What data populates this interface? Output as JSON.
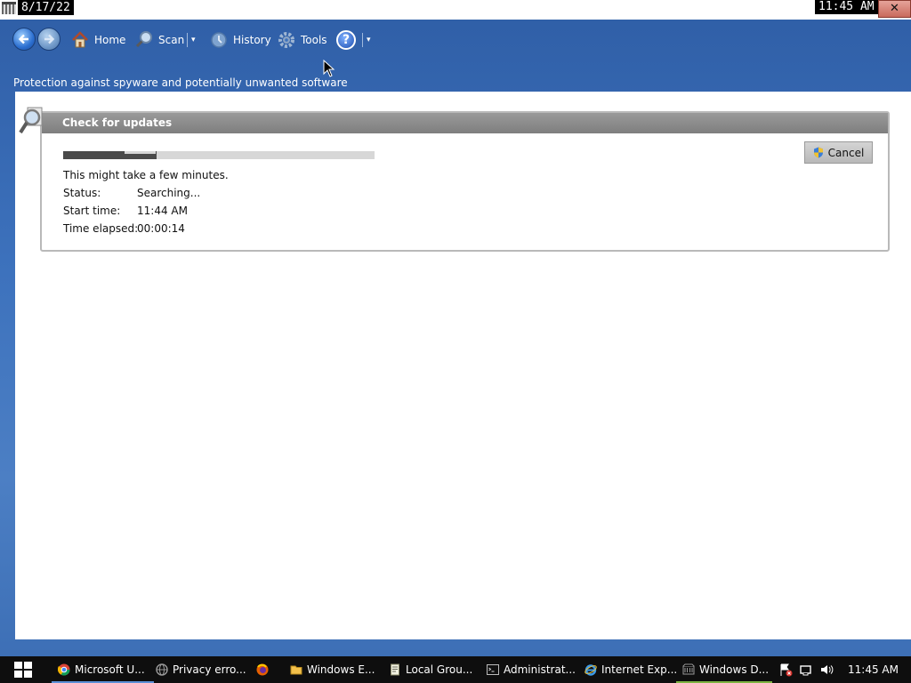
{
  "top_overlay": {
    "date": "8/17/22",
    "time": "11:45 AM",
    "close": "✕"
  },
  "toolbar": {
    "home": "Home",
    "scan": "Scan",
    "history": "History",
    "tools": "Tools",
    "help": "?",
    "dropdown_glyph": "▾"
  },
  "tagline": "Protection against spyware and potentially unwanted software",
  "update_panel": {
    "title": "Check for updates",
    "progress_fraction": 0.3,
    "message": "This might take a few minutes.",
    "cancel_label": "Cancel",
    "rows": [
      {
        "label": "Status:",
        "value": "Searching..."
      },
      {
        "label": "Start time:",
        "value": "11:44 AM"
      },
      {
        "label": "Time elapsed:",
        "value": "00:00:14"
      }
    ]
  },
  "taskbar": {
    "items": [
      {
        "label": "Microsoft U...",
        "icon": "chrome-icon"
      },
      {
        "label": "Privacy erro...",
        "icon": "globe-icon"
      },
      {
        "label": "",
        "icon": "firefox-icon"
      },
      {
        "label": "Windows E...",
        "icon": "folder-icon"
      },
      {
        "label": "Local Grou...",
        "icon": "policy-icon"
      },
      {
        "label": "Administrat...",
        "icon": "cmd-icon"
      },
      {
        "label": "Internet Exp...",
        "icon": "ie-icon"
      },
      {
        "label": "Windows D...",
        "icon": "defender-icon"
      }
    ],
    "clock": "11:45 AM"
  },
  "colors": {
    "desktop_blue": "#3d72bd",
    "panel_header": "#8a8a8a",
    "progress_fill": "#4a4a4a",
    "taskbar": "#0e0e0e"
  }
}
